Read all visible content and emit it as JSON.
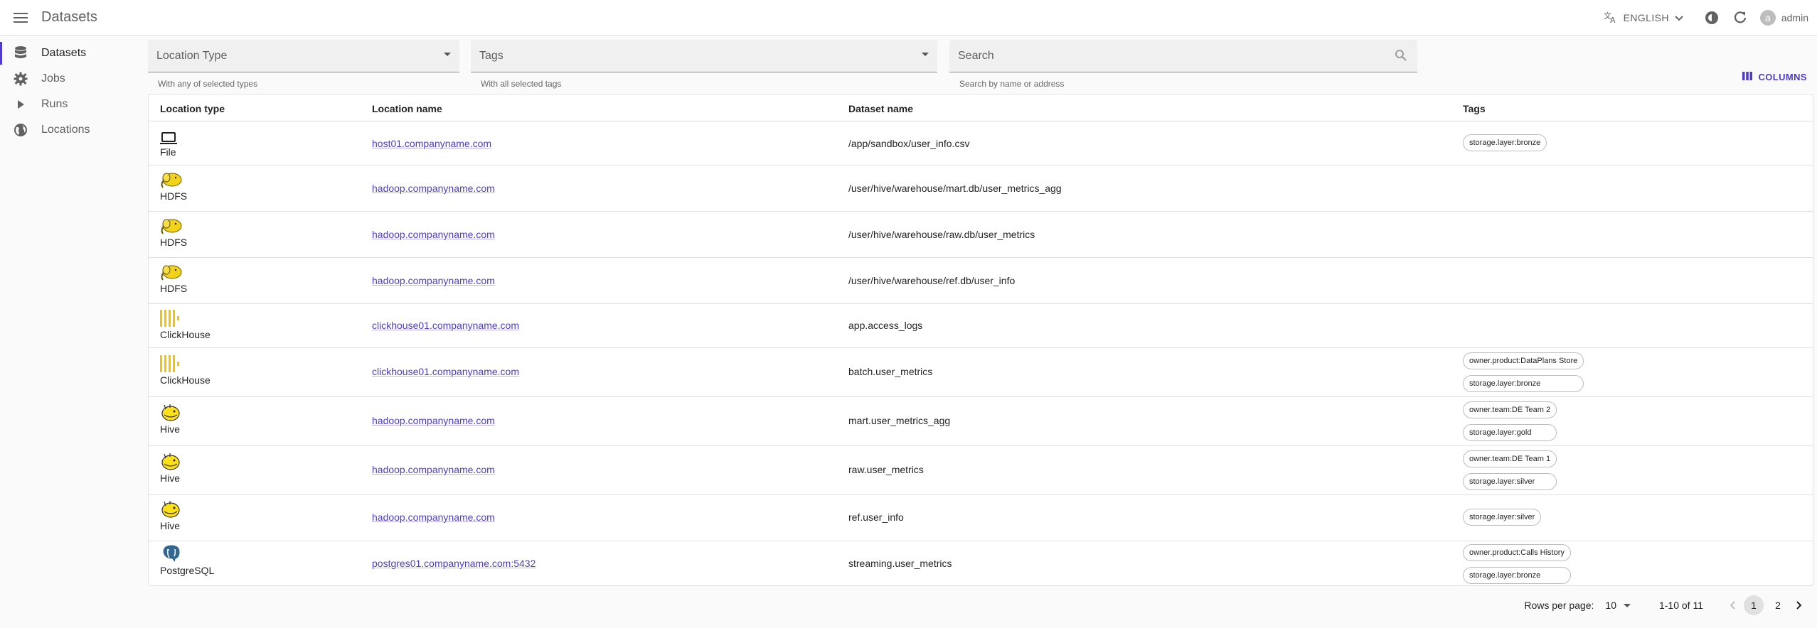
{
  "header": {
    "title": "Datasets",
    "language": "ENGLISH",
    "user_initial": "a",
    "user_name": "admin"
  },
  "sidebar": {
    "items": [
      {
        "label": "Datasets",
        "icon": "database-icon",
        "active": true
      },
      {
        "label": "Jobs",
        "icon": "gear-icon"
      },
      {
        "label": "Runs",
        "icon": "play-icon"
      },
      {
        "label": "Locations",
        "icon": "globe-icon"
      }
    ]
  },
  "filters": {
    "location_type": {
      "placeholder": "Location Type",
      "helper": "With any of selected types"
    },
    "tags": {
      "placeholder": "Tags",
      "helper": "With all selected tags"
    },
    "search": {
      "placeholder": "Search",
      "helper": "Search by name or address"
    }
  },
  "columns_button": "COLUMNS",
  "table": {
    "headers": [
      "Location type",
      "Location name",
      "Dataset name",
      "Tags"
    ],
    "rows": [
      {
        "type": "File",
        "icon": "laptop-icon",
        "location": "host01.companyname.com",
        "dataset": "/app/sandbox/user_info.csv",
        "tags": [
          "storage.layer:bronze"
        ]
      },
      {
        "type": "HDFS",
        "icon": "hadoop-elephant-icon",
        "location": "hadoop.companyname.com",
        "dataset": "/user/hive/warehouse/mart.db/user_metrics_agg",
        "tags": []
      },
      {
        "type": "HDFS",
        "icon": "hadoop-elephant-icon",
        "location": "hadoop.companyname.com",
        "dataset": "/user/hive/warehouse/raw.db/user_metrics",
        "tags": []
      },
      {
        "type": "HDFS",
        "icon": "hadoop-elephant-icon",
        "location": "hadoop.companyname.com",
        "dataset": "/user/hive/warehouse/ref.db/user_info",
        "tags": []
      },
      {
        "type": "ClickHouse",
        "icon": "clickhouse-icon",
        "location": "clickhouse01.companyname.com",
        "dataset": "app.access_logs",
        "tags": []
      },
      {
        "type": "ClickHouse",
        "icon": "clickhouse-icon",
        "location": "clickhouse01.companyname.com",
        "dataset": "batch.user_metrics",
        "tags": [
          "owner.product:DataPlans Store",
          "storage.layer:bronze"
        ]
      },
      {
        "type": "Hive",
        "icon": "hive-bee-icon",
        "location": "hadoop.companyname.com",
        "dataset": "mart.user_metrics_agg",
        "tags": [
          "owner.team:DE Team 2",
          "storage.layer:gold"
        ]
      },
      {
        "type": "Hive",
        "icon": "hive-bee-icon",
        "location": "hadoop.companyname.com",
        "dataset": "raw.user_metrics",
        "tags": [
          "owner.team:DE Team 1",
          "storage.layer:silver"
        ]
      },
      {
        "type": "Hive",
        "icon": "hive-bee-icon",
        "location": "hadoop.companyname.com",
        "dataset": "ref.user_info",
        "tags": [
          "storage.layer:silver"
        ]
      },
      {
        "type": "PostgreSQL",
        "icon": "postgresql-icon",
        "location": "postgres01.companyname.com:5432",
        "dataset": "streaming.user_metrics",
        "tags": [
          "owner.product:Calls History",
          "storage.layer:bronze"
        ]
      }
    ]
  },
  "pagination": {
    "rows_per_page_label": "Rows per page:",
    "rows_per_page": "10",
    "range": "1-10 of 11",
    "pages": [
      "1",
      "2"
    ],
    "current_page": "1"
  },
  "colors": {
    "accent": "#4f3cc9",
    "clickhouse": "#f5c400",
    "hadoop": "#f2d21a",
    "postgres": "#336791"
  }
}
